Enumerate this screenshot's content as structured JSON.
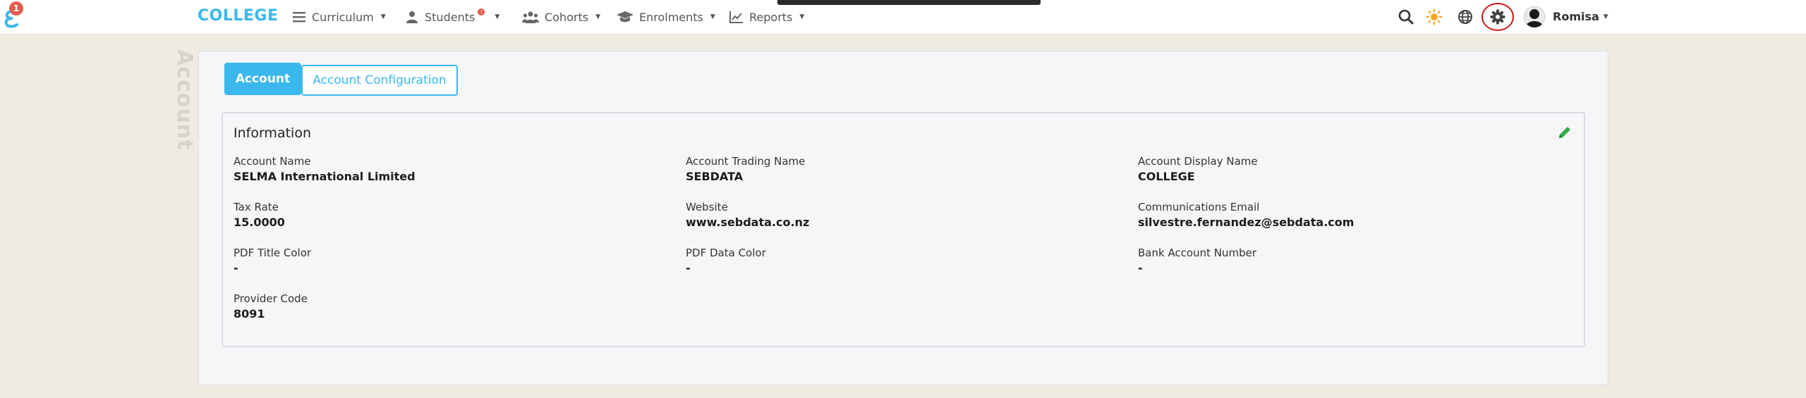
{
  "navbar": {
    "notification_count": "1",
    "brand": "COLLEGE",
    "menu": [
      {
        "label": "Curriculum"
      },
      {
        "label": "Students",
        "badge": "!"
      },
      {
        "label": "Cohorts"
      },
      {
        "label": "Enrolments"
      },
      {
        "label": "Reports"
      }
    ],
    "user_name": "Romisa"
  },
  "page": {
    "vertical_title": "Account"
  },
  "tabs": {
    "account": "Account",
    "configuration": "Account Configuration"
  },
  "card": {
    "title": "Information",
    "fields": [
      {
        "label": "Account Name",
        "value": "SELMA International Limited"
      },
      {
        "label": "Account Trading Name",
        "value": "SEBDATA"
      },
      {
        "label": "Account Display Name",
        "value": "COLLEGE"
      },
      {
        "label": "Tax Rate",
        "value": "15.0000"
      },
      {
        "label": "Website",
        "value": "www.sebdata.co.nz"
      },
      {
        "label": "Communications Email",
        "value": "silvestre.fernandez@sebdata.com"
      },
      {
        "label": "PDF Title Color",
        "value": "-"
      },
      {
        "label": "PDF Data Color",
        "value": "-"
      },
      {
        "label": "Bank Account Number",
        "value": "-"
      },
      {
        "label": "Provider Code",
        "value": "8091"
      }
    ]
  },
  "colors": {
    "accent": "#3ab8ec",
    "badge": "#e35d4f",
    "highlight_ring": "#d11a1a",
    "edit": "#2fae3f"
  }
}
